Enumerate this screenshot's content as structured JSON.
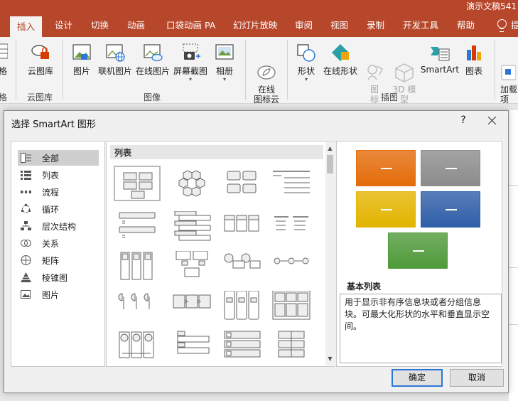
{
  "window": {
    "doc_title": "演示文稿541"
  },
  "tabs": [
    {
      "label": "插入",
      "active": true
    },
    {
      "label": "设计"
    },
    {
      "label": "切换"
    },
    {
      "label": "动画"
    },
    {
      "label": "口袋动画 PA"
    },
    {
      "label": "幻灯片放映"
    },
    {
      "label": "审阅"
    },
    {
      "label": "视图"
    },
    {
      "label": "录制"
    },
    {
      "label": "开发工具"
    },
    {
      "label": "帮助"
    },
    {
      "label": "提"
    }
  ],
  "ribbon": {
    "partial_left_top": "格",
    "partial_left_bottom": "格",
    "cloud_library": "云图库",
    "cloud_library_group": "云图库",
    "picture": "图片",
    "online_picture_linked": "联机图片",
    "online_picture": "在线图片",
    "screenshot": "屏幕截图",
    "album": "相册",
    "images_group": "图像",
    "online_icon_cloud": "在线\n图标云",
    "shapes": "形状",
    "online_shapes": "在线形状",
    "icons": "图\n标",
    "models_3d": "3D 模\n型",
    "smartart": "SmartArt",
    "chart": "图表",
    "illustrations_group": "插图",
    "addins": "加载\n项"
  },
  "dialog": {
    "title": "选择 SmartArt 图形",
    "help": "?",
    "categories": [
      {
        "label": "全部",
        "icon": "all-icon",
        "selected": true
      },
      {
        "label": "列表",
        "icon": "list-icon"
      },
      {
        "label": "流程",
        "icon": "process-icon"
      },
      {
        "label": "循环",
        "icon": "cycle-icon"
      },
      {
        "label": "层次结构",
        "icon": "hierarchy-icon"
      },
      {
        "label": "关系",
        "icon": "relationship-icon"
      },
      {
        "label": "矩阵",
        "icon": "matrix-icon"
      },
      {
        "label": "棱锥图",
        "icon": "pyramid-icon"
      },
      {
        "label": "图片",
        "icon": "picture-icon"
      }
    ],
    "section_header": "列表",
    "preview": {
      "name": "基本列表",
      "description": "用于显示非有序信息块或者分组信息块。可最大化形状的水平和垂直显示空间。",
      "colors": [
        "#e46c0a",
        "#8c8c8c",
        "#e3b400",
        "#2f5ea8",
        "#4f9a3a"
      ]
    },
    "ok_label": "确定",
    "cancel_label": "取消"
  }
}
